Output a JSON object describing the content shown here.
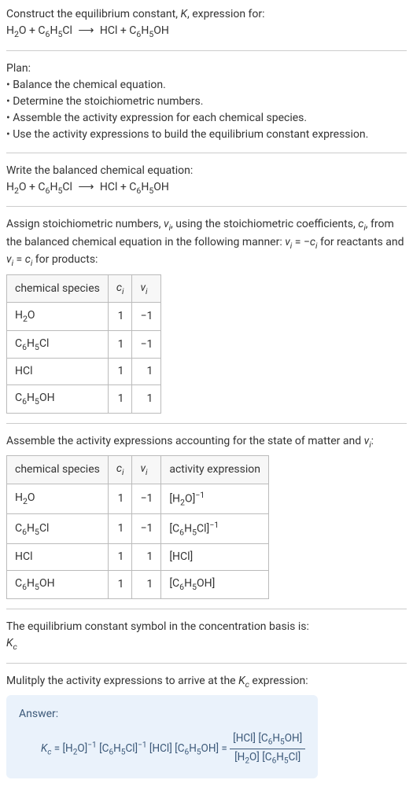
{
  "header": {
    "prompt": "Construct the equilibrium constant, K, expression for:",
    "equation": "H₂O + C₆H₅Cl ⟶ HCl + C₆H₅OH"
  },
  "plan": {
    "title": "Plan:",
    "items": [
      "• Balance the chemical equation.",
      "• Determine the stoichiometric numbers.",
      "• Assemble the activity expression for each chemical species.",
      "• Use the activity expressions to build the equilibrium constant expression."
    ]
  },
  "balanced": {
    "title": "Write the balanced chemical equation:",
    "equation": "H₂O + C₆H₅Cl ⟶ HCl + C₆H₅OH"
  },
  "stoich": {
    "text": "Assign stoichiometric numbers, νᵢ, using the stoichiometric coefficients, cᵢ, from the balanced chemical equation in the following manner: νᵢ = −cᵢ for reactants and νᵢ = cᵢ for products:",
    "headers": [
      "chemical species",
      "cᵢ",
      "νᵢ"
    ],
    "rows": [
      {
        "species": "H₂O",
        "c": "1",
        "nu": "−1"
      },
      {
        "species": "C₆H₅Cl",
        "c": "1",
        "nu": "−1"
      },
      {
        "species": "HCl",
        "c": "1",
        "nu": "1"
      },
      {
        "species": "C₆H₅OH",
        "c": "1",
        "nu": "1"
      }
    ]
  },
  "activity": {
    "text": "Assemble the activity expressions accounting for the state of matter and νᵢ:",
    "headers": [
      "chemical species",
      "cᵢ",
      "νᵢ",
      "activity expression"
    ],
    "rows": [
      {
        "species": "H₂O",
        "c": "1",
        "nu": "−1",
        "expr": "[H₂O]⁻¹"
      },
      {
        "species": "C₆H₅Cl",
        "c": "1",
        "nu": "−1",
        "expr": "[C₆H₅Cl]⁻¹"
      },
      {
        "species": "HCl",
        "c": "1",
        "nu": "1",
        "expr": "[HCl]"
      },
      {
        "species": "C₆H₅OH",
        "c": "1",
        "nu": "1",
        "expr": "[C₆H₅OH]"
      }
    ]
  },
  "symbol": {
    "text": "The equilibrium constant symbol in the concentration basis is:",
    "value": "K_c"
  },
  "multiply": {
    "text": "Mulitply the activity expressions to arrive at the K_c expression:"
  },
  "answer": {
    "label": "Answer:",
    "lhs": "K_c = [H₂O]⁻¹ [C₆H₅Cl]⁻¹ [HCl] [C₆H₅OH] = ",
    "frac_num": "[HCl] [C₆H₅OH]",
    "frac_den": "[H₂O] [C₆H₅Cl]"
  }
}
